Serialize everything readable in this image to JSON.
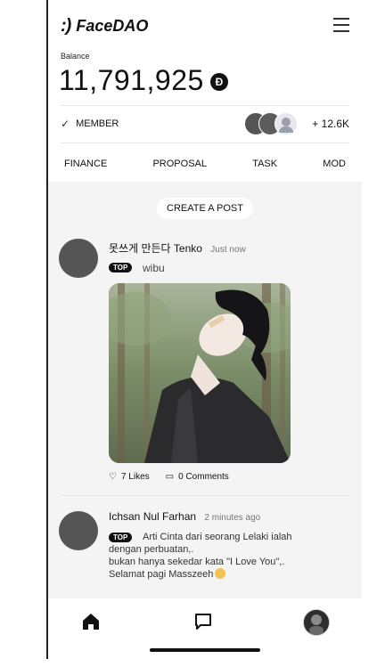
{
  "app": {
    "brand_mark": ":)",
    "brand_name": "FaceDAO",
    "menu_icon": "hamburger-menu-icon"
  },
  "wallet": {
    "balance_label": "Balance",
    "balance_value": "11,791,925",
    "token_icon": "token-icon",
    "token_glyph": "Ð"
  },
  "membership": {
    "label": "MEMBER",
    "count": "+ 12.6K"
  },
  "tabs": [
    {
      "label": "FINANCE"
    },
    {
      "label": "PROPOSAL"
    },
    {
      "label": "TASK"
    },
    {
      "label": "MOD"
    }
  ],
  "feed": {
    "create_post_label": "CREATE A POST",
    "posts": [
      {
        "author": "못쓰게 만든다 Tenko",
        "time": "Just now",
        "badge": "TOP",
        "text": "wibu",
        "likes": "7 Likes",
        "comments": "0 Comments"
      },
      {
        "author": "Ichsan Nul Farhan",
        "time": "2 minutes ago",
        "badge": "TOP",
        "text_line1": "Arti Cinta dari seorang Lelaki ialah",
        "text_line2": "dengan perbuatan,.",
        "text_line3": "bukan hanya sekedar kata \"I Love You\",.",
        "text_line4": "Selamat pagi Masszeeh"
      }
    ]
  },
  "bottom_nav": {
    "items": [
      "home-icon",
      "chat-icon",
      "profile-avatar"
    ]
  },
  "colors": {
    "background": "#ffffff",
    "feed_background": "#f4f4f4",
    "text": "#111111",
    "badge": "#111111"
  }
}
